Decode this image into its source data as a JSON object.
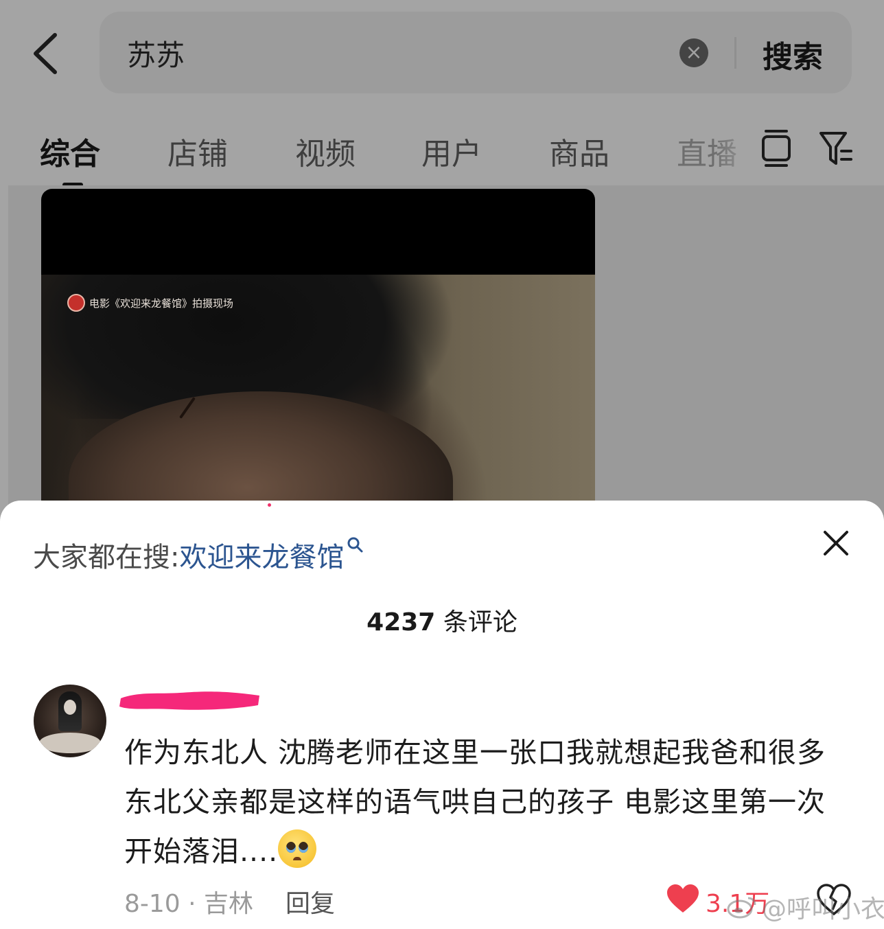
{
  "search": {
    "query": "苏苏",
    "search_label": "搜索"
  },
  "tabs": [
    {
      "label": "综合"
    },
    {
      "label": "店铺"
    },
    {
      "label": "视频"
    },
    {
      "label": "用户"
    },
    {
      "label": "商品"
    },
    {
      "label": "直播"
    }
  ],
  "video": {
    "watermark": "电影《欢迎来龙餐馆》拍摄现场"
  },
  "sheet": {
    "suggest_label": "大家都在搜:",
    "suggest_link": "欢迎来龙餐馆",
    "comment_count": "4237",
    "comment_count_suffix": "条评论"
  },
  "comment": {
    "text": "作为东北人 沈腾老师在这里一张口我就想起我爸和很多东北父亲都是这样的语气哄自己的孩子 电影这里第一次开始落泪....",
    "emoji": "pleading-face-emoji",
    "date_location": "8-10 · 吉林",
    "reply_label": "回复",
    "likes": "3.1万"
  },
  "watermark_overlay": "@呼叫小衣",
  "colors": {
    "link_blue": "#2c5590",
    "like_red": "#ee3f4f",
    "redaction_pink": "#f5287a"
  }
}
